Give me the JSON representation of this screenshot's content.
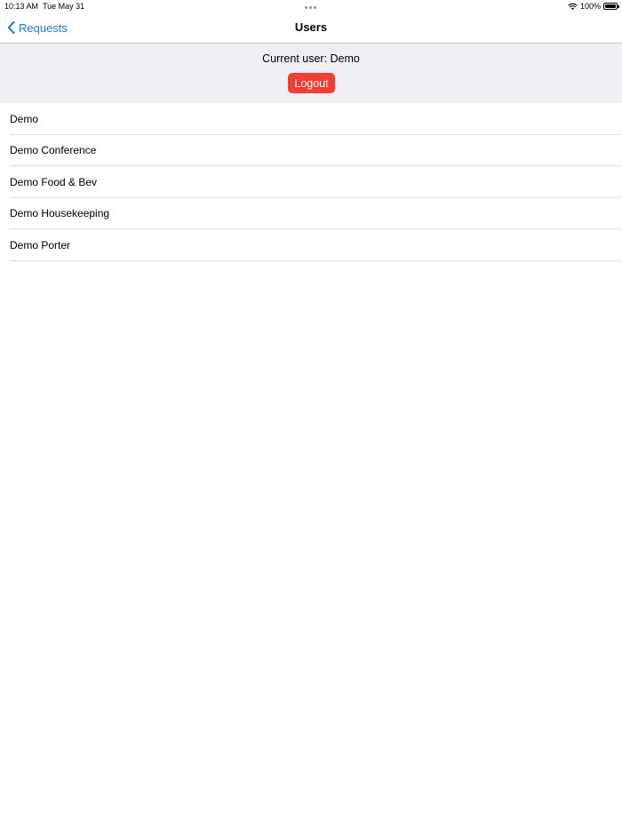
{
  "status_bar": {
    "time": "10:13 AM",
    "date": "Tue May 31",
    "battery": "100%"
  },
  "nav": {
    "back_label": "Requests",
    "title": "Users"
  },
  "session": {
    "current_user_text": "Current user: Demo",
    "logout_label": "Logout"
  },
  "users": [
    {
      "name": "Demo"
    },
    {
      "name": "Demo Conference"
    },
    {
      "name": "Demo Food & Bev"
    },
    {
      "name": "Demo Housekeeping"
    },
    {
      "name": "Demo Porter"
    }
  ],
  "colors": {
    "accent": "#1a7cd9",
    "logout": "#f43d33",
    "panel": "#efeff4"
  }
}
